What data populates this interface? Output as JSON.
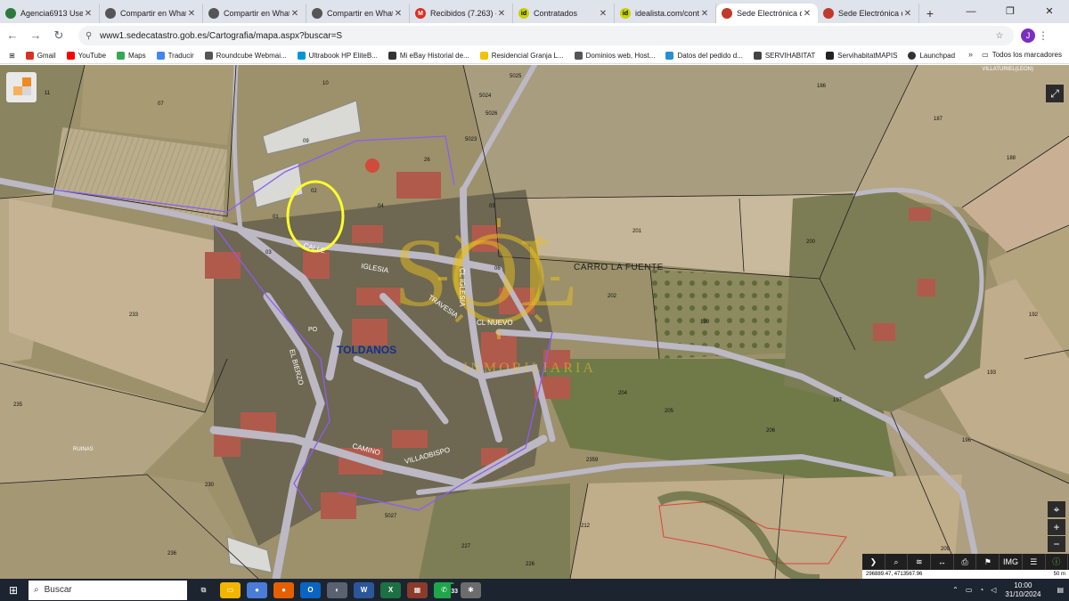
{
  "tabs": [
    {
      "title": "Agencia6913 User...",
      "favicon_color": "#2a7a3b",
      "icon": "agency-icon",
      "active": false
    },
    {
      "title": "Compartir en Whatsa...",
      "favicon_color": "#555555",
      "icon": "globe-icon",
      "active": false
    },
    {
      "title": "Compartir en Whatsa...",
      "favicon_color": "#555555",
      "icon": "globe-icon",
      "active": false
    },
    {
      "title": "Compartir en Whatsa...",
      "favicon_color": "#555555",
      "icon": "globe-icon",
      "active": false
    },
    {
      "title": "Recibidos (7.263) - jo...",
      "favicon_color": "#d93025",
      "icon": "gmail-icon",
      "active": false
    },
    {
      "title": "Contratados",
      "favicon_color": "#c8d400",
      "icon": "idealista-icon",
      "active": false
    },
    {
      "title": "idealista.com/contro...",
      "favicon_color": "#c8d400",
      "icon": "idealista-icon",
      "active": false
    },
    {
      "title": "Sede Electrónica del...",
      "favicon_color": "#c0392b",
      "icon": "catastro-icon",
      "active": true
    },
    {
      "title": "Sede Electrónica del...",
      "favicon_color": "#c0392b",
      "icon": "catastro-icon",
      "active": false
    }
  ],
  "address_bar": {
    "url": "www1.sedecatastro.gob.es/Cartografia/mapa.aspx?buscar=S",
    "avatar_letter": "J"
  },
  "bookmarks": [
    {
      "label": "Gmail",
      "color": "#d93025"
    },
    {
      "label": "YouTube",
      "color": "#ff0000"
    },
    {
      "label": "Maps",
      "color": "#34a853"
    },
    {
      "label": "Traducir",
      "color": "#4285f4"
    },
    {
      "label": "Roundcube Webmai...",
      "color": "#555555"
    },
    {
      "label": "Ultrabook HP EliteB...",
      "color": "#0096d6"
    },
    {
      "label": "Mi eBay Historial de...",
      "color": "#333333"
    },
    {
      "label": "Residencial Granja L...",
      "color": "#f2c200"
    },
    {
      "label": "Dominios web, Host...",
      "color": "#555555"
    },
    {
      "label": "Datos del pedido d...",
      "color": "#2a8fd0"
    },
    {
      "label": "SERVIHABITAT",
      "color": "#444444"
    },
    {
      "label": "ServihabitatMAPIS",
      "color": "#222222"
    },
    {
      "label": "Launchpad",
      "color": "#333333"
    }
  ],
  "bookmarks_all": "Todos los marcadores",
  "map": {
    "corner_label": "VILLATURIEL(LEON)",
    "labels": {
      "toldanos": "TOLDANOS",
      "carro_la_fuente": "CARRO LA FUENTE",
      "calle": "CALLE",
      "iglesia": "IGLESIA",
      "cl_iglesia": "CL IGLESIA",
      "cl_nuevo": "CL NUEVO",
      "travesia": "TRAVESIA",
      "el_bierzo": "EL BIERZO",
      "camino": "CAMINO",
      "villaobispo": "VILLAOBISPO",
      "ruinas": "RUINAS",
      "po": "PO"
    },
    "parcels": [
      "07",
      "10",
      "09",
      "11",
      "26",
      "02",
      "01",
      "03",
      "04",
      "05",
      "06",
      "233",
      "235",
      "230",
      "236",
      "201",
      "200",
      "202",
      "199",
      "204",
      "205",
      "206",
      "212",
      "227",
      "226",
      "209",
      "196",
      "193",
      "192",
      "187",
      "186",
      "188",
      "197",
      "5023",
      "5024",
      "5025",
      "5026",
      "5027",
      "2359"
    ],
    "watermark_text": "SOL",
    "watermark_sub": "INMOBILIARIA"
  },
  "map_controls": {
    "toolbar_icons": [
      "arrow-icon",
      "search-icon",
      "layers-icon",
      "measure-icon",
      "print-icon",
      "pin-icon",
      "img-icon",
      "stack-icon",
      "info-icon"
    ],
    "img_label": "IMG",
    "scale_label": "50 m",
    "coordinates": "296889.47, 4713567.96"
  },
  "taskbar": {
    "search_placeholder": "Buscar",
    "whatsapp_badge": "33",
    "time": "10:00",
    "date": "31/10/2024"
  }
}
